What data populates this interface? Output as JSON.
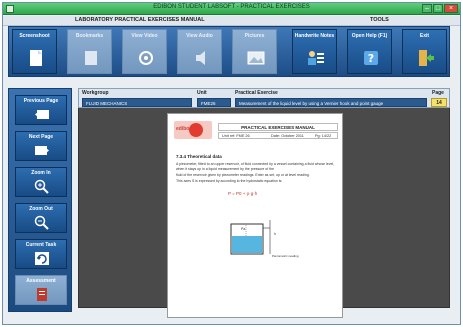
{
  "window": {
    "title": "EDIBON STUDENT LABSOFT - PRACTICAL EXERCISES"
  },
  "menubar": {
    "left": "LABORATORY PRACTICAL EXERCISES MANUAL",
    "right": "TOOLS"
  },
  "toolbar": {
    "buttons": [
      {
        "label": "Screenshoot",
        "icon": "screenshot-icon",
        "enabled": true
      },
      {
        "label": "Bookmarks",
        "icon": "bookmark-icon",
        "enabled": false
      },
      {
        "label": "View Video",
        "icon": "video-icon",
        "enabled": false
      },
      {
        "label": "View Audio",
        "icon": "audio-icon",
        "enabled": false
      },
      {
        "label": "Pictures",
        "icon": "picture-icon",
        "enabled": false
      },
      {
        "label": "Handwrite Notes",
        "icon": "notes-icon",
        "enabled": true
      },
      {
        "label": "Open Help (F1)",
        "icon": "help-icon",
        "enabled": true
      },
      {
        "label": "Exit",
        "icon": "exit-icon",
        "enabled": true
      }
    ]
  },
  "infobar": {
    "workgroup_header": "Workgroup",
    "workgroup_value": "FLUID MECHANICS",
    "unit_header": "Unit",
    "unit_value": "FME26",
    "exercise_header": "Practical Exercise",
    "exercise_value": "Measurement of the liquid level by using a Vernier hook and point gauge",
    "page_header": "Page",
    "page_value": "14"
  },
  "sidebar": {
    "buttons": [
      {
        "label": "Previous Page",
        "icon": "previous-page-icon",
        "enabled": true
      },
      {
        "label": "Next Page",
        "icon": "next-page-icon",
        "enabled": true
      },
      {
        "label": "Zoom In",
        "icon": "zoom-in-icon",
        "enabled": true
      },
      {
        "label": "Zoom Out",
        "icon": "zoom-out-icon",
        "enabled": true
      },
      {
        "label": "Current Task",
        "icon": "current-task-icon",
        "enabled": true
      },
      {
        "label": "Assessment",
        "icon": "assessment-icon",
        "enabled": false
      }
    ]
  },
  "sheet": {
    "logo_text": "edibon",
    "title": "PRACTICAL EXERCISES MANUAL",
    "unit_ref": "Unit ref: FME 26",
    "date": "Date: October 2011",
    "page_ref": "Pg: 14/22",
    "section": "7.3.4   Theoretical data",
    "paragraph_1": "A piezometer, fitted to an upper reservoir, of fluid connected by a vessel containing a fluid whose level, when it stays up in a liquid measurement by the pressure of the",
    "paragraph_2": "fluid of the reservoir given by piezometer readings. Enter as set, up or at level reading.",
    "paragraph_3": "This axes S is expressed by according to the hydrostatic equation is:",
    "formula": "P = P0 + ρ·g·h",
    "diagram_label_1": "Pa",
    "diagram_label_2": "h",
    "diagram_label_3": "Piezometric reading"
  },
  "colors": {
    "titlebar": "#3dbb5c",
    "toolbar": "#2a62a0",
    "page_bg": "#4a4a4a",
    "page_badge": "#f4e36a"
  }
}
